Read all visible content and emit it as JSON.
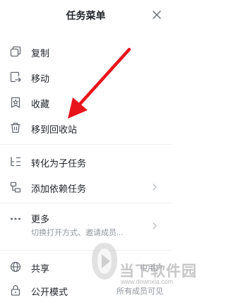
{
  "header": {
    "title": "任务菜单"
  },
  "items": {
    "copy": {
      "label": "复制"
    },
    "move": {
      "label": "移动"
    },
    "favorite": {
      "label": "收藏"
    },
    "recycle": {
      "label": "移到回收站"
    },
    "convert": {
      "label": "转化为子任务"
    },
    "dependency": {
      "label": "添加依赖任务"
    },
    "more": {
      "label": "更多",
      "sub": "切换打开方式、邀请成员..."
    },
    "share": {
      "label": "共享",
      "right": "中用户"
    },
    "public": {
      "label": "公开模式",
      "right": "所有成员可见"
    }
  },
  "watermark": {
    "text": "当下软件园",
    "url": "www.downxia.com"
  },
  "colors": {
    "arrow": "#e8141c",
    "icon": "#646a73",
    "divider": "#eceef1",
    "secondary": "#8f959e"
  }
}
